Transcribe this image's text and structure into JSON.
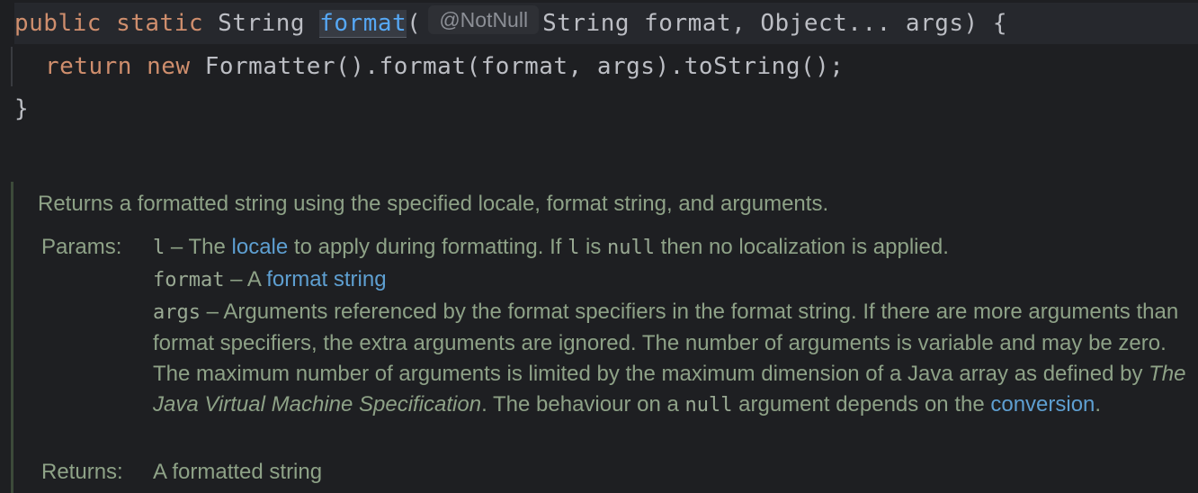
{
  "code": {
    "line1": {
      "kw_public": "public",
      "kw_static": "static",
      "return_type": "String",
      "method_name": "format",
      "open_paren": "(",
      "inlay_hint": "@NotNull",
      "params": "String format, Object... args) {"
    },
    "line2": {
      "kw_return": "return",
      "kw_new": "new",
      "rest": "Formatter().format(format, args).toString();"
    },
    "line3": {
      "closing": "}"
    }
  },
  "doc": {
    "summary": "Returns a formatted string using the specified locale, format string, and arguments.",
    "params_label": "Params:",
    "returns_label": "Returns:",
    "param_l": {
      "name": "l",
      "dash": " – The ",
      "link": "locale",
      "text1": " to apply during formatting. If ",
      "code1": "l",
      "text2": " is ",
      "code2": "null",
      "text3": " then no localization is applied."
    },
    "param_format": {
      "name": "format",
      "dash": " – A ",
      "link": "format string"
    },
    "param_args": {
      "name": "args",
      "text1": " – Arguments referenced by the format specifiers in the format string. If there are more arguments than format specifiers, the extra arguments are ignored. The number of arguments is variable and may be zero. The maximum number of arguments is limited by the maximum dimension of a Java array as defined by ",
      "italic": "The Java Virtual Machine Specification",
      "text2": ". The behaviour on a ",
      "code": "null",
      "text3": " argument depends on the ",
      "link": "conversion",
      "text4": "."
    },
    "returns_text": "A formatted string"
  },
  "colors": {
    "background": "#1e1f22",
    "keyword": "#cf8e6d",
    "method": "#56a8f5",
    "doc_text": "#8ea287",
    "doc_link": "#5e9fd1"
  }
}
